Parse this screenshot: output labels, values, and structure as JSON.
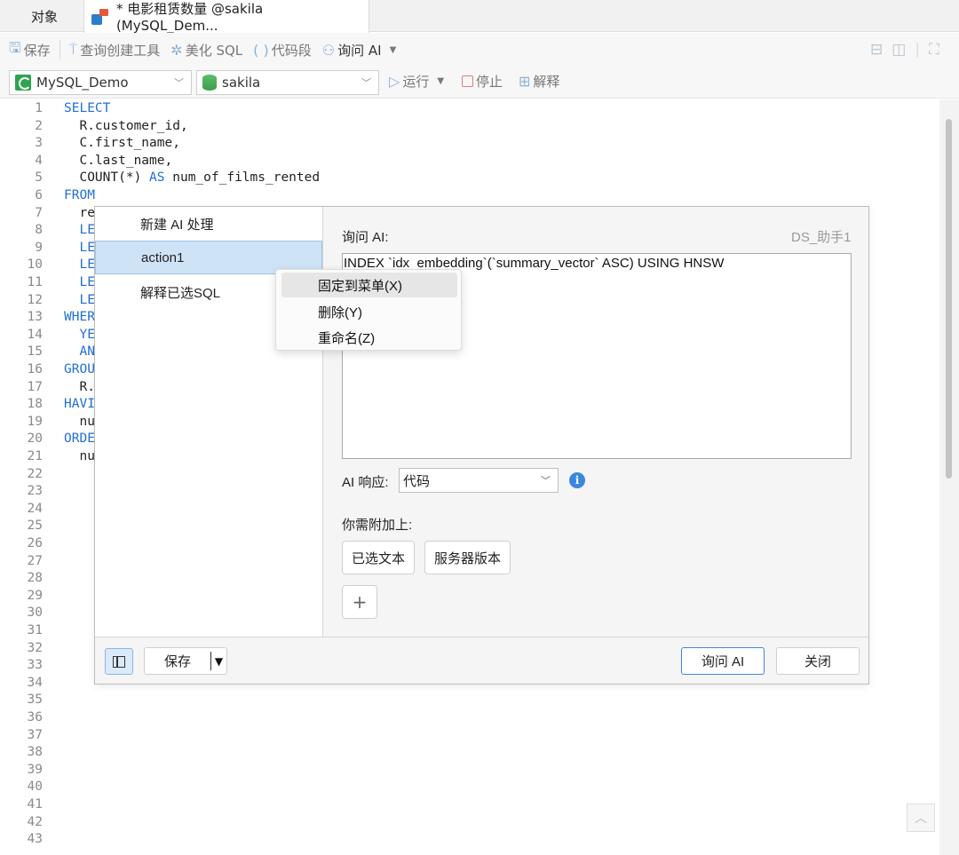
{
  "tabs": {
    "objects_label": "对象",
    "query_label": "* 电影租赁数量 @sakila (MySQL_Dem..."
  },
  "toolbar": {
    "save_label": "保存",
    "query_builder_label": "查询创建工具",
    "beautify_label": "美化 SQL",
    "snippet_label": "代码段",
    "ask_ai_label": "询问 AI",
    "connection": "MySQL_Demo",
    "database": "sakila",
    "run_label": "运行",
    "stop_label": "停止",
    "explain_label": "解释"
  },
  "editor": {
    "line_numbers": [
      "1",
      "2",
      "3",
      "4",
      "5",
      "6",
      "7",
      "8",
      "9",
      "10",
      "11",
      "12",
      "13",
      "14",
      "15",
      "16",
      "17",
      "18",
      "19",
      "20",
      "21",
      "22",
      "23",
      "24",
      "25",
      "26",
      "27",
      "28",
      "29",
      "30",
      "31",
      "32",
      "33",
      "34",
      "35",
      "36",
      "37",
      "38",
      "39",
      "40",
      "41",
      "42",
      "43"
    ],
    "lines": [
      [
        {
          "t": "SELECT",
          "k": true
        }
      ],
      [
        {
          "t": "  R.customer_id,",
          "k": false
        }
      ],
      [
        {
          "t": "  C.first_name,",
          "k": false
        }
      ],
      [
        {
          "t": "  C.last_name,",
          "k": false
        }
      ],
      [
        {
          "t": "  COUNT(*) ",
          "k": false
        },
        {
          "t": "AS",
          "k": true
        },
        {
          "t": " num_of_films_rented",
          "k": false
        }
      ],
      [
        {
          "t": "FROM",
          "k": true
        }
      ],
      [
        {
          "t": "  re",
          "k": false
        }
      ],
      [
        {
          "t": "  LE",
          "k": true
        }
      ],
      [
        {
          "t": "  LE",
          "k": true
        }
      ],
      [
        {
          "t": "  LE",
          "k": true
        }
      ],
      [
        {
          "t": "  LE",
          "k": true
        }
      ],
      [
        {
          "t": "  LE",
          "k": true
        }
      ],
      [
        {
          "t": "WHER",
          "k": true
        }
      ],
      [
        {
          "t": "  YE",
          "k": true
        }
      ],
      [
        {
          "t": "  AN",
          "k": true
        }
      ],
      [
        {
          "t": "GROU",
          "k": true
        }
      ],
      [
        {
          "t": "  R.",
          "k": false
        }
      ],
      [
        {
          "t": "HAVI",
          "k": true
        }
      ],
      [
        {
          "t": "  nu",
          "k": false
        }
      ],
      [
        {
          "t": "ORDE",
          "k": true
        }
      ],
      [
        {
          "t": "  nu",
          "k": false
        }
      ]
    ]
  },
  "ai_dialog": {
    "actions": [
      "新建 AI 处理",
      "action1",
      "解释已选SQL"
    ],
    "selected_action": "action1",
    "ask_label": "询问 AI:",
    "assistant_name": "DS_助手1",
    "prompt_text": "INDEX `idx_embedding`(`summary_vector` ASC) USING HNSW",
    "response_label": "AI 响应:",
    "response_value": "代码",
    "attach_label": "你需附加上:",
    "attach_chips": [
      "已选文本",
      "服务器版本"
    ],
    "add_symbol": "+",
    "save_label": "保存",
    "ask_button": "询问 AI",
    "close_button": "关闭"
  },
  "context_menu": {
    "items": [
      "固定到菜单(X)",
      "删除(Y)",
      "重命名(Z)"
    ]
  },
  "colors": {
    "keyword": "#1f6fd6",
    "selection": "#cfe3f7",
    "accent": "#3b86e0"
  }
}
